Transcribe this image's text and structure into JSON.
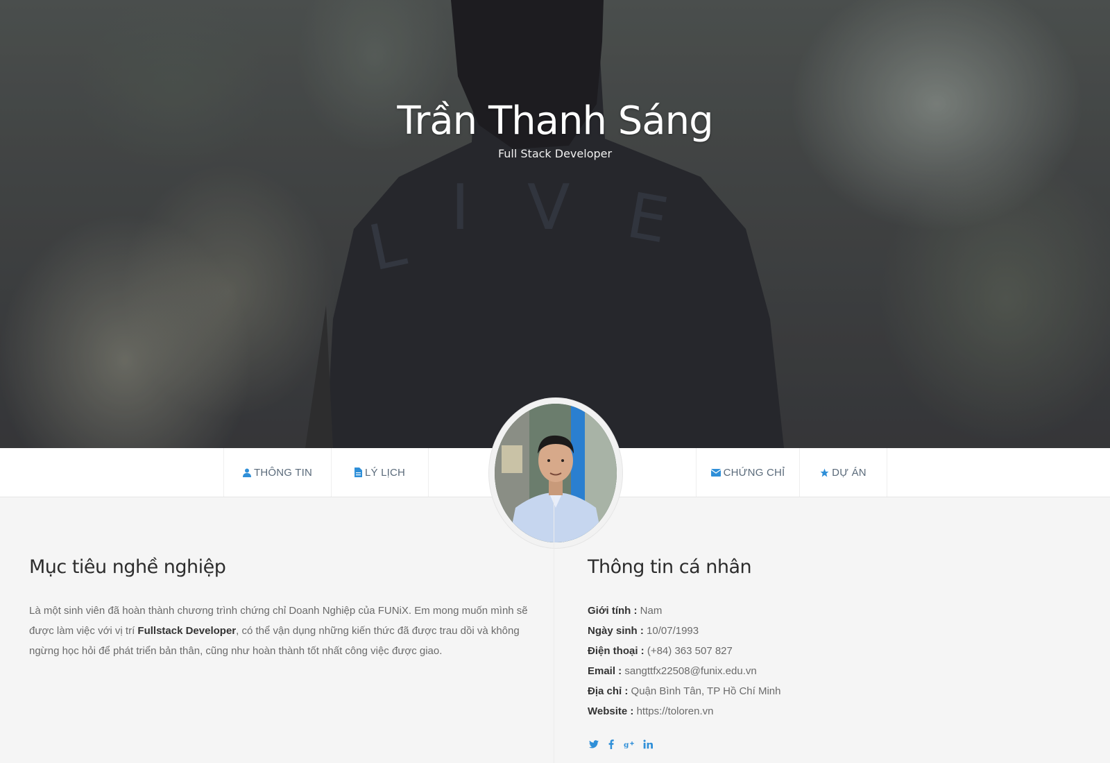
{
  "hero": {
    "name": "Trần Thanh Sáng",
    "title": "Full Stack Developer"
  },
  "nav": {
    "items": [
      {
        "label": "THÔNG TIN",
        "icon": "user-icon"
      },
      {
        "label": "LÝ LỊCH",
        "icon": "file-icon"
      },
      {
        "label": "CHỨNG CHỈ",
        "icon": "envelope-icon"
      },
      {
        "label": "DỰ ÁN",
        "icon": "star-icon"
      }
    ]
  },
  "objective": {
    "heading": "Mục tiêu nghề nghiệp",
    "text_before": "Là một sinh viên đã hoàn thành chương trình chứng chỉ Doanh Nghiệp của FUNiX. Em mong muốn mình sẽ được làm việc với vị trí ",
    "highlight": "Fullstack Developer",
    "text_after": ", có thể vận dụng những kiến thức đã được trau dồi và không ngừng học hỏi để phát triển bản thân, cũng như hoàn thành tốt nhất công việc được giao."
  },
  "personal": {
    "heading": "Thông tin cá nhân",
    "rows": [
      {
        "label": "Giới tính :",
        "value": " Nam"
      },
      {
        "label": "Ngày sinh :",
        "value": " 10/07/1993"
      },
      {
        "label": "Điện thoại :",
        "value": " (+84) 363 507 827"
      },
      {
        "label": "Email :",
        "value": " sangttfx22508@funix.edu.vn"
      },
      {
        "label": "Địa chỉ :",
        "value": " Quận Bình Tân, TP Hồ Chí Minh"
      },
      {
        "label": "Website :",
        "value": " https://toloren.vn"
      }
    ]
  },
  "socials": [
    {
      "icon": "twitter-icon",
      "glyph": "🐦"
    },
    {
      "icon": "facebook-icon",
      "glyph": "f"
    },
    {
      "icon": "google-plus-icon",
      "glyph": "g+"
    },
    {
      "icon": "linkedin-icon",
      "glyph": "in"
    }
  ],
  "colors": {
    "accent": "#2f8fd8",
    "background": "#f5f5f5",
    "heading": "#2d2d2d"
  }
}
